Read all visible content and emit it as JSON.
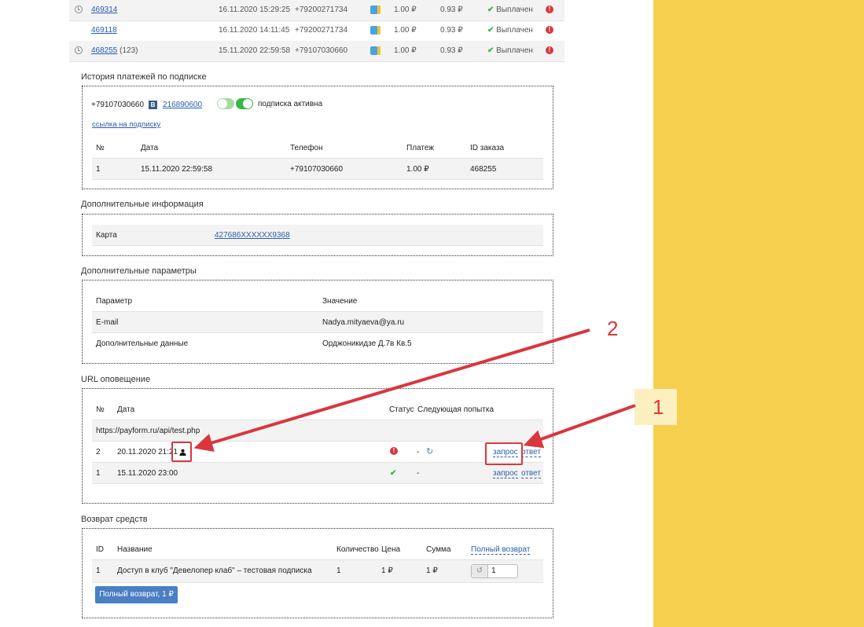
{
  "orders": [
    {
      "id": "469314",
      "extra": "",
      "date": "16.11.2020 15:29:25",
      "phone": "+79200271734",
      "amount": "1.00 ₽",
      "net": "0.93 ₽",
      "status": "Выплачен",
      "clock": true,
      "gray": true
    },
    {
      "id": "469118",
      "extra": "",
      "date": "16.11.2020 14:11:45",
      "phone": "+79200271734",
      "amount": "1.00 ₽",
      "net": "0.93 ₽",
      "status": "Выплачен",
      "clock": false,
      "gray": false
    },
    {
      "id": "468255",
      "extra": "(123)",
      "date": "15.11.2020 22:59:58",
      "phone": "+79107030660",
      "amount": "1.00 ₽",
      "net": "0.93 ₽",
      "status": "Выплачен",
      "clock": true,
      "gray": true
    }
  ],
  "subscription": {
    "title": "История платежей по подписке",
    "phone": "+79107030660",
    "vk_id": "216890600",
    "active_label": "подписка активна",
    "link_label": "ссылка на подписку",
    "headers": [
      "№",
      "Дата",
      "Телефон",
      "Платеж",
      "ID заказа"
    ],
    "row": [
      "1",
      "15.11.2020 22:59:58",
      "+79107030660",
      "1.00 ₽",
      "468255"
    ]
  },
  "extra_info": {
    "title": "Дополнительные информация",
    "card_label": "Карта",
    "card_value": "427686XXXXXX9368"
  },
  "extra_params": {
    "title": "Дополнительные параметры",
    "headers": [
      "Параметр",
      "Значение"
    ],
    "rows": [
      [
        "E-mail",
        "Nadya.mityaeva@ya.ru"
      ],
      [
        "Дополнительные данные",
        "Орджоникидзе Д.7в Кв.5"
      ]
    ]
  },
  "url_notify": {
    "title": "URL оповещение",
    "headers": [
      "№",
      "Дата",
      "Статус",
      "Следующая попытка"
    ],
    "url": "https://payform.ru/api/test.php",
    "rows": [
      {
        "num": "2",
        "date": "20.11.2020 21:21",
        "next": "-",
        "request": "запрос",
        "response": "ответ"
      },
      {
        "num": "1",
        "date": "15.11.2020 23:00",
        "next": "-",
        "request": "запрос",
        "response": "ответ"
      }
    ]
  },
  "refund": {
    "title": "Возврат средств",
    "headers": [
      "ID",
      "Название",
      "Количество",
      "Цена",
      "Сумма"
    ],
    "full_refund_link": "Полный возврат",
    "row": [
      "1",
      "Доступ в клуб \"Девелопер клаб\" – тестовая подписка",
      "1",
      "1 ₽",
      "1 ₽"
    ],
    "stepper_value": "1",
    "button_label": "Полный возврат, 1 ₽"
  },
  "annotations": {
    "label_1": "1",
    "label_2": "2"
  },
  "colors": {
    "accent_yellow": "#f7cf4f",
    "annotation_red": "#d9363e",
    "primary_button": "#4a7fc4",
    "success_green": "#3ab54a"
  }
}
